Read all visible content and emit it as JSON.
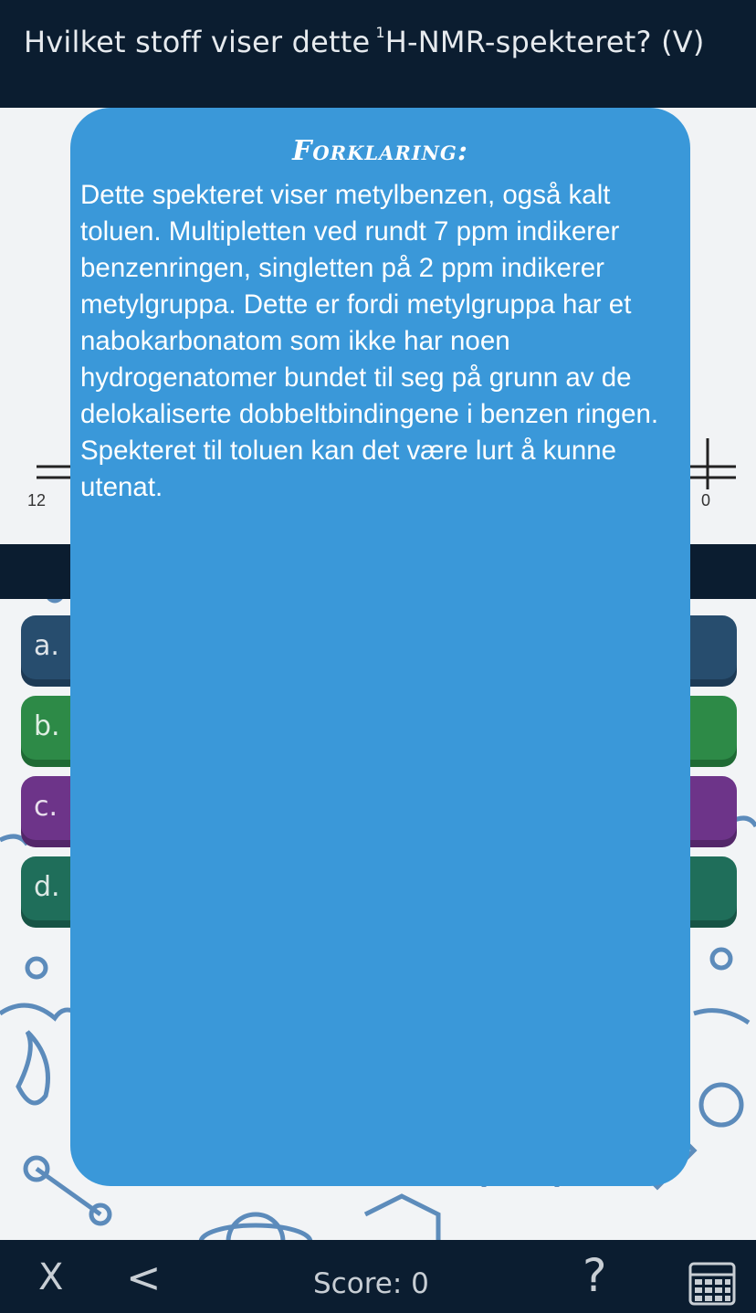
{
  "header": {
    "question_prefix": "Hvilket stoff viser dette",
    "question_sup": "1",
    "question_suffix": "H-NMR-spekteret?  (V)"
  },
  "spectrum": {
    "axis_left_label": "12",
    "axis_right_label": "0"
  },
  "options": [
    {
      "letter": "a.",
      "color": "#274d6e"
    },
    {
      "letter": "b.",
      "color": "#2d8a47"
    },
    {
      "letter": "c.",
      "color": "#6d3489"
    },
    {
      "letter": "d.",
      "color": "#1f6e5a"
    }
  ],
  "modal": {
    "title": "Forklaring:",
    "body": "Dette spekteret viser metylbenzen, også kalt toluen. Multipletten ved rundt 7 ppm indikerer benzenringen, singletten på 2 ppm indikerer metylgruppa. Dette er fordi metylgruppa har et nabokarbonatom som ikke har noen hydrogenatomer bundet til seg på grunn av de delokaliserte dobbeltbindingene i benzen ringen. Spekteret til toluen kan det være lurt å kunne utenat.",
    "background": "#3a98d9"
  },
  "footer": {
    "close_label": "X",
    "back_label": "<",
    "score_text": "Score: 0",
    "help_label": "?",
    "calculator_icon": "calculator-icon"
  }
}
